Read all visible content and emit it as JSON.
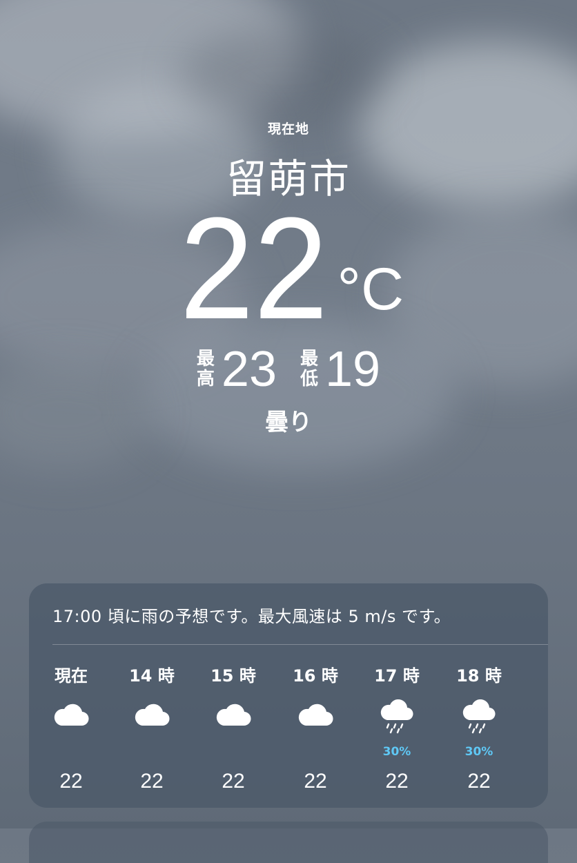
{
  "header": {
    "location_label": "現在地",
    "city": "留萌市",
    "temperature": "22",
    "unit": "°C",
    "high_label_top": "最",
    "high_label_bottom": "高",
    "high_value": "23",
    "low_label_top": "最",
    "low_label_bottom": "低",
    "low_value": "19",
    "condition": "曇り"
  },
  "forecast": {
    "summary": "17:00 頃に雨の予想です。最大風速は 5 m/s です。",
    "hours": [
      {
        "label": "現在",
        "icon": "cloud-icon",
        "precip": "",
        "temp": "22"
      },
      {
        "label": "14 時",
        "icon": "cloud-icon",
        "precip": "",
        "temp": "22"
      },
      {
        "label": "15 時",
        "icon": "cloud-icon",
        "precip": "",
        "temp": "22"
      },
      {
        "label": "16 時",
        "icon": "cloud-icon",
        "precip": "",
        "temp": "22"
      },
      {
        "label": "17 時",
        "icon": "cloud-rain-icon",
        "precip": "30%",
        "temp": "22"
      },
      {
        "label": "18 時",
        "icon": "cloud-rain-icon",
        "precip": "30%",
        "temp": "22"
      }
    ]
  },
  "colors": {
    "precip_accent": "#5fc8f5",
    "card_background": "#4a5868"
  }
}
